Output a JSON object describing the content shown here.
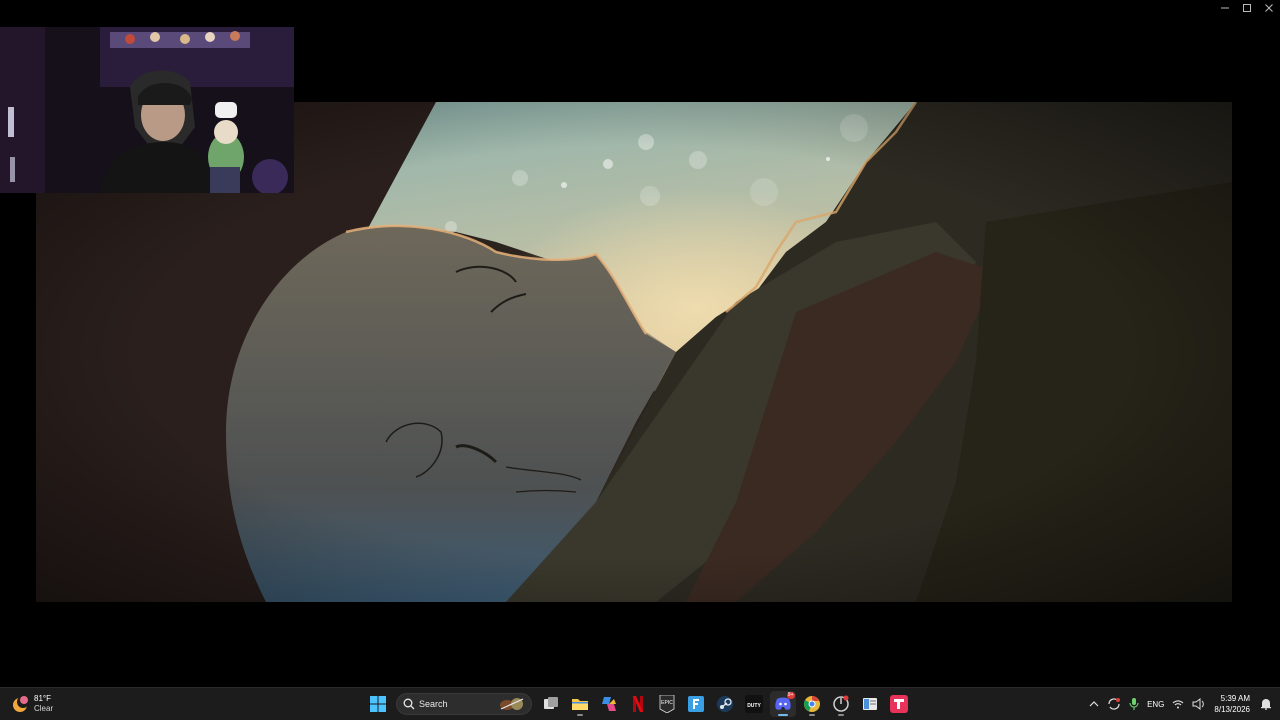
{
  "weather": {
    "temperature": "81°F",
    "condition": "Clear"
  },
  "taskbar": {
    "search_label": "Search",
    "apps": [
      {
        "name": "Start"
      },
      {
        "name": "Search"
      },
      {
        "name": "Task View"
      },
      {
        "name": "File Explorer"
      },
      {
        "name": "Copilot"
      },
      {
        "name": "Netflix"
      },
      {
        "name": "Epic Games"
      },
      {
        "name": "Frame"
      },
      {
        "name": "Steam"
      },
      {
        "name": "Call of Duty"
      },
      {
        "name": "Discord",
        "badge": "9+"
      },
      {
        "name": "Chrome"
      },
      {
        "name": "Game Bar"
      },
      {
        "name": "Notepad"
      },
      {
        "name": "TwitchStudio"
      }
    ],
    "epic_label": "EPIC",
    "cod_label": "DUTY",
    "discord_badge": "9+"
  },
  "tray": {
    "language": "ENG"
  },
  "clock": {
    "time": "5:39 AM",
    "date": "8/13/2026"
  },
  "colors": {
    "taskbar_bg": "#1c1c1c",
    "accent": "#76b9ed"
  }
}
